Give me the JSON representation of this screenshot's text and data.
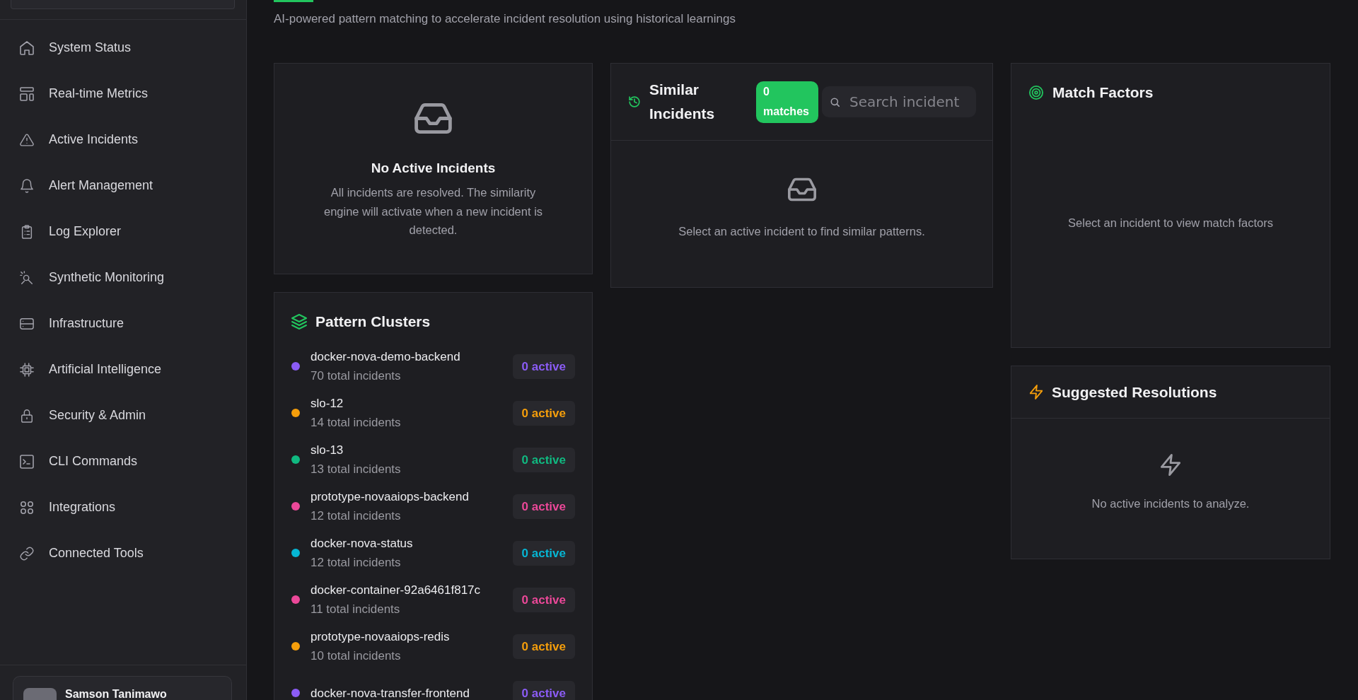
{
  "sidebar": {
    "nav_items": [
      {
        "label": "System Status",
        "selected": false
      },
      {
        "label": "Real-time Metrics",
        "selected": false
      },
      {
        "label": "Active Incidents",
        "selected": false
      },
      {
        "label": "Alert Management",
        "selected": false
      },
      {
        "label": "Log Explorer",
        "selected": false
      },
      {
        "label": "Synthetic Monitoring",
        "selected": false
      },
      {
        "label": "Infrastructure",
        "selected": false
      },
      {
        "label": "Artificial Intelligence",
        "selected": false
      },
      {
        "label": "Security & Admin",
        "selected": false
      },
      {
        "label": "CLI Commands",
        "selected": false
      },
      {
        "label": "Integrations",
        "selected": false
      },
      {
        "label": "Connected Tools",
        "selected": false
      }
    ],
    "user": {
      "name": "Samson Tanimawo"
    }
  },
  "header": {
    "subtitle": "AI-powered pattern matching to accelerate incident resolution using historical learnings"
  },
  "active_incidents": {
    "title": "No Active Incidents",
    "message": "All incidents are resolved. The similarity engine will activate when a new incident is detected."
  },
  "pattern_clusters": {
    "title": "Pattern Clusters",
    "clusters": [
      {
        "name": "docker-nova-demo-backend",
        "total": "70 total incidents",
        "active": "0 active",
        "color": "#8b5cf6"
      },
      {
        "name": "slo-12",
        "total": "14 total incidents",
        "active": "0 active",
        "color": "#f59e0b"
      },
      {
        "name": "slo-13",
        "total": "13 total incidents",
        "active": "0 active",
        "color": "#10b981"
      },
      {
        "name": "prototype-novaaiops-backend",
        "total": "12 total incidents",
        "active": "0 active",
        "color": "#ec4899"
      },
      {
        "name": "docker-nova-status",
        "total": "12 total incidents",
        "active": "0 active",
        "color": "#06b6d4"
      },
      {
        "name": "docker-container-92a6461f817c",
        "total": "11 total incidents",
        "active": "0 active",
        "color": "#ec4899"
      },
      {
        "name": "prototype-novaaiops-redis",
        "total": "10 total incidents",
        "active": "0 active",
        "color": "#f59e0b"
      },
      {
        "name": "docker-nova-transfer-frontend",
        "active": "0 active",
        "color": "#8b5cf6"
      }
    ]
  },
  "similar_incidents": {
    "title": "Similar Incidents",
    "matches": "0 matches",
    "search": {
      "placeholder": "Search incident"
    },
    "message": "Select an active incident to find similar patterns."
  },
  "match_factors": {
    "title": "Match Factors",
    "message": "Select an incident to view match factors"
  },
  "suggested_resolutions": {
    "title": "Suggested Resolutions",
    "message": "No active incidents to analyze."
  }
}
